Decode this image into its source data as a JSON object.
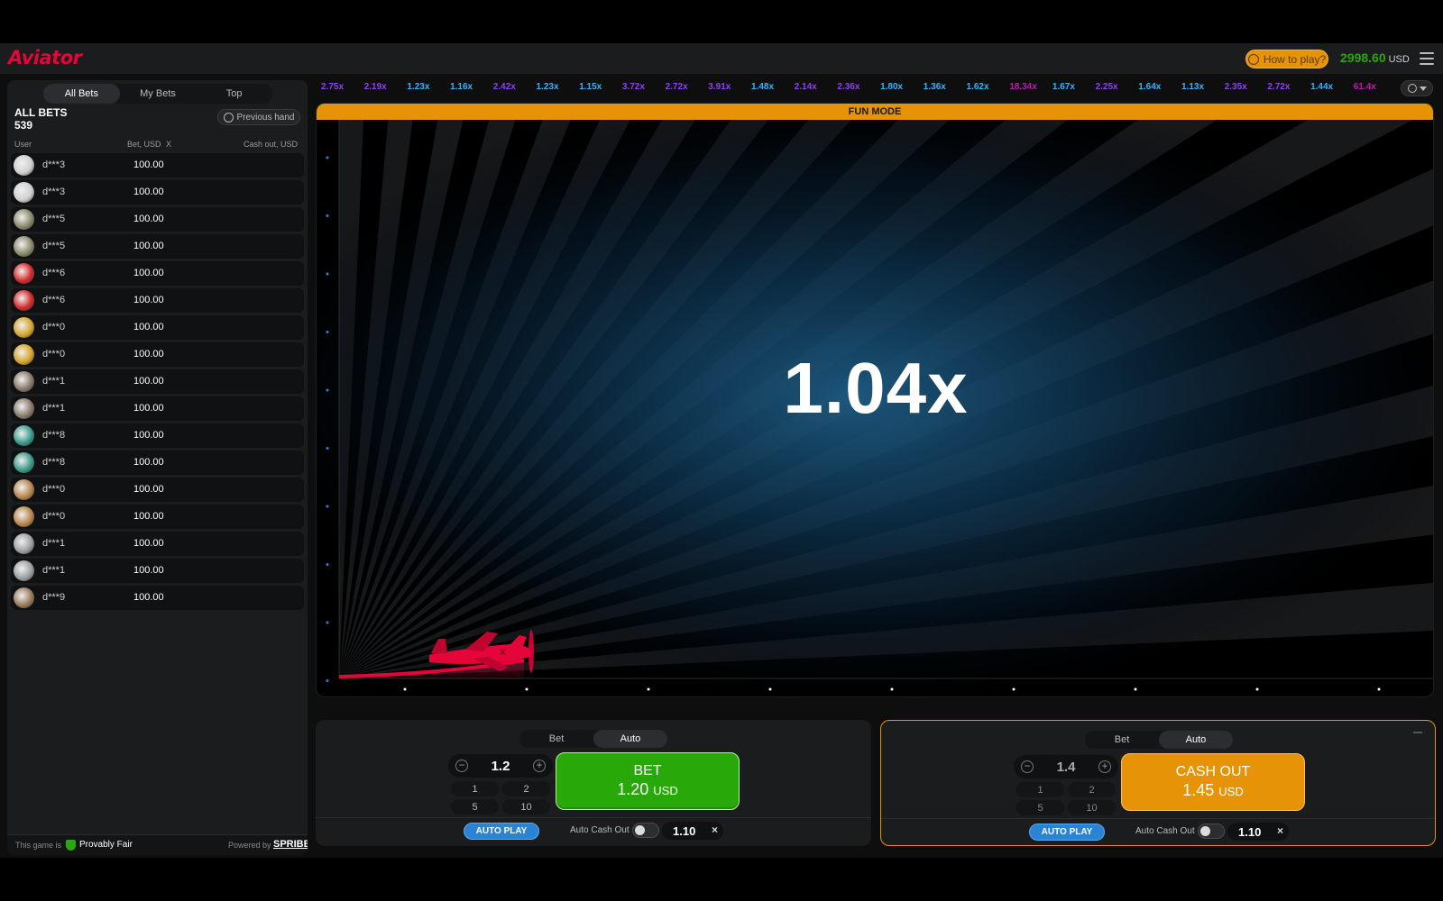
{
  "header": {
    "logo": "Aviator",
    "how_to_play": "How to play?",
    "balance": "2998.60",
    "currency": "USD"
  },
  "left_panel": {
    "tabs": [
      "All Bets",
      "My Bets",
      "Top"
    ],
    "active_tab": "All Bets",
    "title": "ALL BETS",
    "count": "539",
    "previous_hand": "Previous hand",
    "columns": {
      "user": "User",
      "bet": "Bet, USD",
      "x": "X",
      "cashout": "Cash out, USD"
    },
    "bets": [
      {
        "user": "d***3",
        "amount": "100.00",
        "avatar_color": "#cfcfcf"
      },
      {
        "user": "d***3",
        "amount": "100.00",
        "avatar_color": "#cfcfcf"
      },
      {
        "user": "d***5",
        "amount": "100.00",
        "avatar_color": "#8a8a6a"
      },
      {
        "user": "d***5",
        "amount": "100.00",
        "avatar_color": "#8a8a6a"
      },
      {
        "user": "d***6",
        "amount": "100.00",
        "avatar_color": "#d42a2a"
      },
      {
        "user": "d***6",
        "amount": "100.00",
        "avatar_color": "#d42a2a"
      },
      {
        "user": "d***0",
        "amount": "100.00",
        "avatar_color": "#d6a62a"
      },
      {
        "user": "d***0",
        "amount": "100.00",
        "avatar_color": "#d6a62a"
      },
      {
        "user": "d***1",
        "amount": "100.00",
        "avatar_color": "#8a7a6a"
      },
      {
        "user": "d***1",
        "amount": "100.00",
        "avatar_color": "#8a7a6a"
      },
      {
        "user": "d***8",
        "amount": "100.00",
        "avatar_color": "#3a9a8a"
      },
      {
        "user": "d***8",
        "amount": "100.00",
        "avatar_color": "#3a9a8a"
      },
      {
        "user": "d***0",
        "amount": "100.00",
        "avatar_color": "#b8864a"
      },
      {
        "user": "d***0",
        "amount": "100.00",
        "avatar_color": "#b8864a"
      },
      {
        "user": "d***1",
        "amount": "100.00",
        "avatar_color": "#9aa0a0"
      },
      {
        "user": "d***1",
        "amount": "100.00",
        "avatar_color": "#9aa0a0"
      },
      {
        "user": "d***9",
        "amount": "100.00",
        "avatar_color": "#9a7a5a"
      }
    ],
    "footer": {
      "this_game_is": "This game is",
      "provably_fair": "Provably Fair",
      "powered_by": "Powered by",
      "brand": "SPRIBE"
    }
  },
  "history": [
    {
      "value": "2.75x",
      "color": "#913ef8"
    },
    {
      "value": "2.19x",
      "color": "#913ef8"
    },
    {
      "value": "1.23x",
      "color": "#34b4ff"
    },
    {
      "value": "1.16x",
      "color": "#34b4ff"
    },
    {
      "value": "2.42x",
      "color": "#913ef8"
    },
    {
      "value": "1.23x",
      "color": "#34b4ff"
    },
    {
      "value": "1.15x",
      "color": "#34b4ff"
    },
    {
      "value": "3.72x",
      "color": "#913ef8"
    },
    {
      "value": "2.72x",
      "color": "#913ef8"
    },
    {
      "value": "3.91x",
      "color": "#913ef8"
    },
    {
      "value": "1.48x",
      "color": "#34b4ff"
    },
    {
      "value": "2.14x",
      "color": "#913ef8"
    },
    {
      "value": "2.36x",
      "color": "#913ef8"
    },
    {
      "value": "1.80x",
      "color": "#34b4ff"
    },
    {
      "value": "1.36x",
      "color": "#34b4ff"
    },
    {
      "value": "1.62x",
      "color": "#34b4ff"
    },
    {
      "value": "18.34x",
      "color": "#c017b4"
    },
    {
      "value": "1.67x",
      "color": "#34b4ff"
    },
    {
      "value": "2.25x",
      "color": "#913ef8"
    },
    {
      "value": "1.64x",
      "color": "#34b4ff"
    },
    {
      "value": "1.13x",
      "color": "#34b4ff"
    },
    {
      "value": "2.35x",
      "color": "#913ef8"
    },
    {
      "value": "2.72x",
      "color": "#913ef8"
    },
    {
      "value": "1.44x",
      "color": "#34b4ff"
    },
    {
      "value": "61.4x",
      "color": "#c017b4"
    }
  ],
  "game": {
    "banner": "FUN MODE",
    "multiplier": "1.04x"
  },
  "panels": [
    {
      "tabs": [
        "Bet",
        "Auto"
      ],
      "active_tab": "Auto",
      "stake": "1.2",
      "quick": [
        "1",
        "2",
        "5",
        "10"
      ],
      "button_title": "BET",
      "button_amount": "1.20",
      "button_currency": "USD",
      "auto_play": "AUTO PLAY",
      "auto_cash_out_label": "Auto Cash Out",
      "auto_cash_out_value": "1.10",
      "clear": "×"
    },
    {
      "tabs": [
        "Bet",
        "Auto"
      ],
      "active_tab": "Auto",
      "stake": "1.4",
      "quick": [
        "1",
        "2",
        "5",
        "10"
      ],
      "button_title": "CASH OUT",
      "button_amount": "1.45",
      "button_currency": "USD",
      "auto_play": "AUTO PLAY",
      "auto_cash_out_label": "Auto Cash Out",
      "auto_cash_out_value": "1.10",
      "clear": "×"
    }
  ],
  "colors": {
    "accent_red": "#e50539",
    "green": "#28a909",
    "orange": "#e69308",
    "blue": "#2a83d3"
  }
}
